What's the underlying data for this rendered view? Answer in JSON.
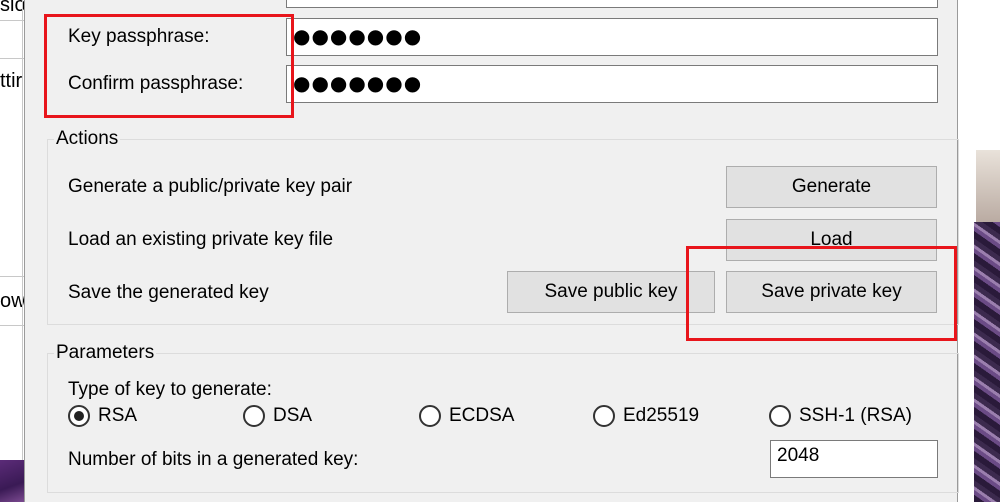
{
  "background_window": {
    "fragments": [
      "sio",
      "ttir",
      "ow"
    ]
  },
  "passphrase": {
    "key_label": "Key passphrase:",
    "key_value": "●●●●●●●",
    "confirm_label": "Confirm passphrase:",
    "confirm_value": "●●●●●●●"
  },
  "actions": {
    "title": "Actions",
    "generate_desc": "Generate a public/private key pair",
    "generate_button": "Generate",
    "load_desc": "Load an existing private key file",
    "load_button": "Load",
    "save_desc": "Save the generated key",
    "save_public_button": "Save public key",
    "save_private_button": "Save private key"
  },
  "parameters": {
    "title": "Parameters",
    "type_label": "Type of key to generate:",
    "key_types": [
      {
        "label": "RSA",
        "selected": true
      },
      {
        "label": "DSA",
        "selected": false
      },
      {
        "label": "ECDSA",
        "selected": false
      },
      {
        "label": "Ed25519",
        "selected": false
      },
      {
        "label": "SSH-1 (RSA)",
        "selected": false
      }
    ],
    "bits_label": "Number of bits in a generated key:",
    "bits_value": "2048"
  },
  "colors": {
    "highlight": "#e8151b",
    "dialog_bg": "#f0f0f0",
    "button_bg": "#e1e1e1"
  }
}
